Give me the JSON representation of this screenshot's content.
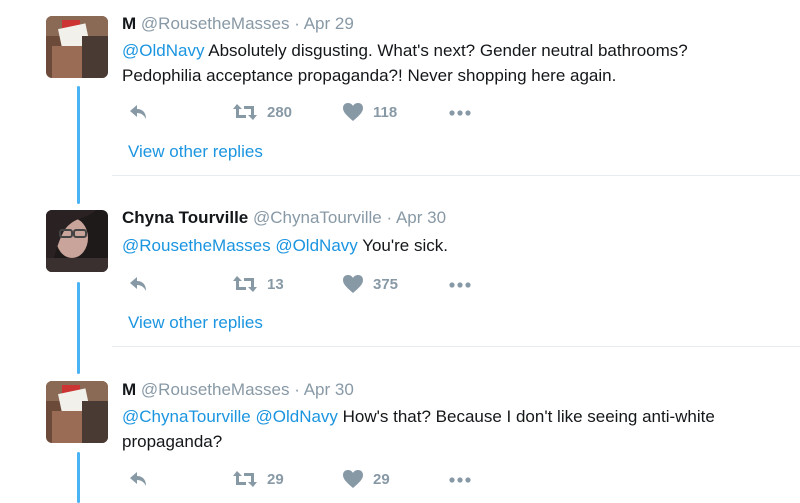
{
  "tweets": [
    {
      "name": "M",
      "handle": "@RousetheMasses",
      "sep": "·",
      "date": "Apr 29",
      "mentions": "@OldNavy",
      "line1": " Absolutely disgusting. What's next? Gender neutral bathrooms?",
      "line2": "Pedophilia acceptance propaganda?! Never shopping here again.",
      "retweets": "280",
      "likes": "118",
      "view_replies": "View other replies"
    },
    {
      "name": "Chyna Tourville",
      "handle": "@ChynaTourville",
      "sep": "·",
      "date": "Apr 30",
      "mentions": "@RousetheMasses @OldNavy",
      "line1": " You're sick.",
      "retweets": "13",
      "likes": "375",
      "view_replies": "View other replies"
    },
    {
      "name": "M",
      "handle": "@RousetheMasses",
      "sep": "·",
      "date": "Apr 30",
      "mentions": "@ChynaTourville @OldNavy",
      "line1": " How's that? Because I don't like seeing anti-white",
      "line2": "propaganda?",
      "retweets": "29",
      "likes": "29"
    }
  ],
  "colors": {
    "accent": "#1b95e0",
    "thread_line": "#4ab3f4",
    "muted": "#8899a6"
  },
  "icons": [
    "reply-icon",
    "retweet-icon",
    "like-icon",
    "more-icon"
  ]
}
